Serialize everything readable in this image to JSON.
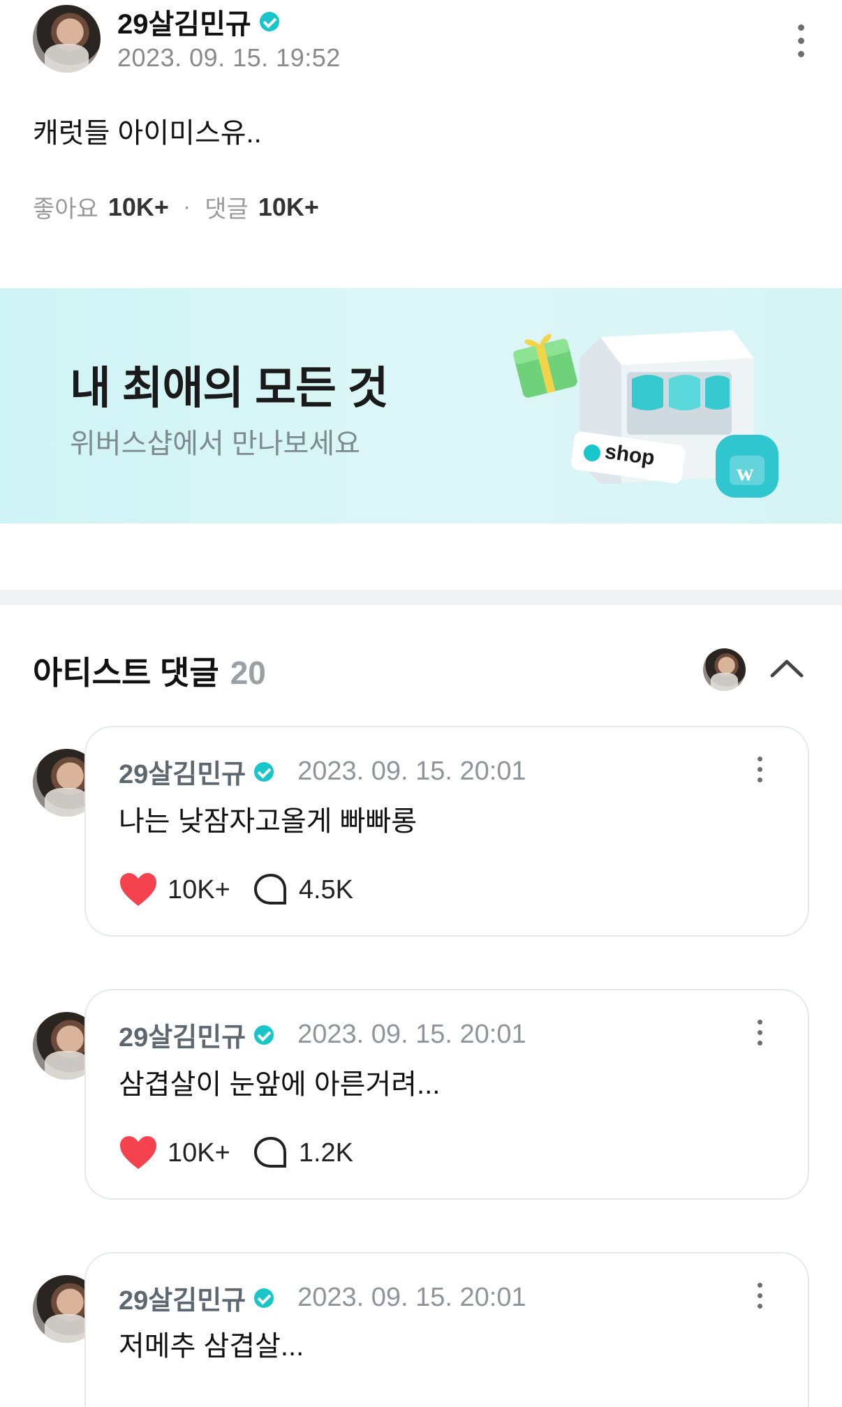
{
  "post": {
    "author": "29살김민규",
    "timestamp": "2023. 09. 15. 19:52",
    "body": "캐럿들 아이미스유..",
    "likes_label": "좋아요",
    "likes_count": "10K+",
    "separator": "·",
    "comments_label": "댓글",
    "comments_count": "10K+"
  },
  "banner": {
    "title": "내 최애의 모든 것",
    "subtitle": "위버스샵에서 만나보세요",
    "shop_label": "shop",
    "bag_label": "w"
  },
  "artist_comments": {
    "title": "아티스트 댓글",
    "count": "20",
    "items": [
      {
        "author": "29살김민규",
        "timestamp": "2023. 09. 15. 20:01",
        "text": "나는 낮잠자고올게 빠빠롱",
        "likes": "10K+",
        "replies": "4.5K"
      },
      {
        "author": "29살김민규",
        "timestamp": "2023. 09. 15. 20:01",
        "text": "삼겹살이 눈앞에 아른거려...",
        "likes": "10K+",
        "replies": "1.2K"
      },
      {
        "author": "29살김민규",
        "timestamp": "2023. 09. 15. 20:01",
        "text": "저메추 삼겹살..."
      }
    ]
  },
  "colors": {
    "accent": "#18c6c9",
    "heart": "#f4434f",
    "banner_bg": "#d6f4f5"
  }
}
